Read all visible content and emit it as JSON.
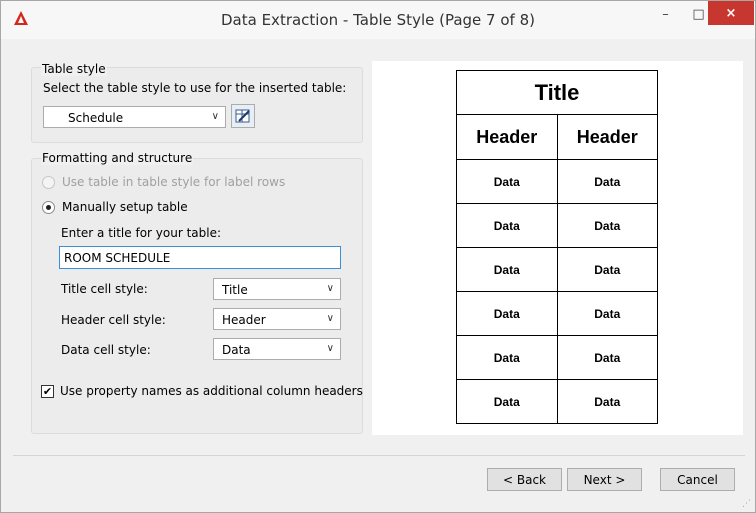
{
  "window": {
    "title": "Data Extraction - Table Style (Page 7 of 8)",
    "minimize": "–",
    "maximize": "□",
    "close": "×"
  },
  "table_style": {
    "group_label": "Table style",
    "instruction": "Select the table style to use for the inserted table:",
    "selected": "Schedule"
  },
  "formatting": {
    "group_label": "Formatting and structure",
    "radio_label_rows": "Use table in table style for label rows",
    "radio_manual": "Manually setup table",
    "title_prompt": "Enter a title for your table:",
    "title_value": "ROOM SCHEDULE",
    "title_cell_label": "Title cell style:",
    "title_cell_value": "Title",
    "header_cell_label": "Header cell style:",
    "header_cell_value": "Header",
    "data_cell_label": "Data cell style:",
    "data_cell_value": "Data",
    "checkbox_label": "Use property names as additional column headers"
  },
  "preview": {
    "title": "Title",
    "headers": [
      "Header",
      "Header"
    ],
    "rows": [
      [
        "Data",
        "Data"
      ],
      [
        "Data",
        "Data"
      ],
      [
        "Data",
        "Data"
      ],
      [
        "Data",
        "Data"
      ],
      [
        "Data",
        "Data"
      ],
      [
        "Data",
        "Data"
      ]
    ]
  },
  "buttons": {
    "back": "< Back",
    "next": "Next >",
    "cancel": "Cancel"
  },
  "colors": {
    "close_button": "#c7372f",
    "focus_border": "#3b8ed8",
    "app_icon": "#d3261f"
  }
}
